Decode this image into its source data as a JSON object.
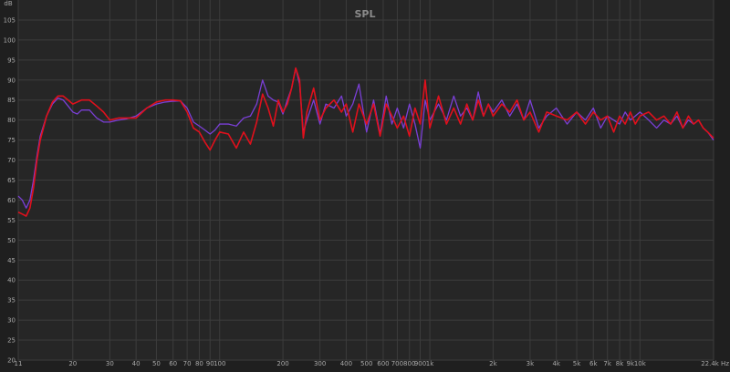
{
  "chart_data": {
    "type": "line",
    "title": "SPL",
    "ylabel": "dB",
    "xunit": "Hz",
    "xscale": "log",
    "grid": true,
    "xlim": [
      11,
      22400
    ],
    "ylim": [
      20,
      110
    ],
    "yticks": [
      20,
      25,
      30,
      35,
      40,
      45,
      50,
      55,
      60,
      65,
      70,
      75,
      80,
      85,
      90,
      95,
      100,
      105
    ],
    "xticks": [
      {
        "v": 11,
        "label": "11"
      },
      {
        "v": 20,
        "label": "20"
      },
      {
        "v": 30,
        "label": "30"
      },
      {
        "v": 40,
        "label": "40"
      },
      {
        "v": 50,
        "label": "50"
      },
      {
        "v": 60,
        "label": "60"
      },
      {
        "v": 70,
        "label": "70"
      },
      {
        "v": 80,
        "label": "80"
      },
      {
        "v": 90,
        "label": "90"
      },
      {
        "v": 100,
        "label": "100"
      },
      {
        "v": 200,
        "label": "200"
      },
      {
        "v": 300,
        "label": "300"
      },
      {
        "v": 400,
        "label": "400"
      },
      {
        "v": 500,
        "label": "500"
      },
      {
        "v": 600,
        "label": "600"
      },
      {
        "v": 700,
        "label": "700"
      },
      {
        "v": 800,
        "label": "800"
      },
      {
        "v": 900,
        "label": "900"
      },
      {
        "v": 1000,
        "label": "1k"
      },
      {
        "v": 2000,
        "label": "2k"
      },
      {
        "v": 3000,
        "label": "3k"
      },
      {
        "v": 4000,
        "label": "4k"
      },
      {
        "v": 5000,
        "label": "5k"
      },
      {
        "v": 6000,
        "label": "6k"
      },
      {
        "v": 7000,
        "label": "7k"
      },
      {
        "v": 8000,
        "label": "8k"
      },
      {
        "v": 9000,
        "label": "9k"
      },
      {
        "v": 10000,
        "label": "10k"
      },
      {
        "v": 22400,
        "label": "22.4k Hz"
      }
    ],
    "colors": {
      "series1": "#7a3fd6",
      "series2": "#e0101c",
      "background": "#262626",
      "grid": "#3c3c3c",
      "text": "#a8a8a8"
    },
    "series": [
      {
        "color": "#7a3fd6",
        "x": [
          11,
          11.5,
          12,
          12.5,
          13,
          13.5,
          14,
          15,
          16,
          17,
          18,
          19,
          20,
          21,
          22,
          24,
          26,
          28,
          30,
          33,
          36,
          40,
          45,
          50,
          55,
          60,
          65,
          70,
          75,
          80,
          85,
          90,
          95,
          100,
          110,
          120,
          130,
          140,
          150,
          160,
          170,
          180,
          190,
          200,
          210,
          220,
          230,
          240,
          250,
          260,
          280,
          300,
          320,
          350,
          380,
          400,
          430,
          460,
          500,
          540,
          580,
          620,
          660,
          700,
          750,
          800,
          850,
          900,
          950,
          1000,
          1100,
          1200,
          1300,
          1400,
          1500,
          1600,
          1700,
          1800,
          1900,
          2000,
          2200,
          2400,
          2600,
          2800,
          3000,
          3300,
          3600,
          4000,
          4500,
          5000,
          5500,
          6000,
          6500,
          7000,
          7500,
          8000,
          8500,
          9000,
          9500,
          10000,
          11000,
          12000,
          13000,
          14000,
          15000,
          16000,
          17000,
          18000,
          19000,
          20000,
          21000,
          22400
        ],
        "y": [
          61,
          60,
          58,
          60,
          65,
          71,
          76,
          81,
          84,
          85.5,
          85,
          83.5,
          82,
          81.5,
          82.5,
          82.5,
          80.5,
          79.5,
          79.5,
          80,
          80.3,
          81,
          83,
          84,
          84.5,
          84.7,
          84.8,
          83,
          79.5,
          78.5,
          77.5,
          76.5,
          77.5,
          79,
          79,
          78.5,
          80.5,
          81,
          84,
          90,
          86,
          85,
          84.5,
          81.5,
          85,
          88,
          93,
          89,
          77,
          80,
          85,
          79,
          84,
          83,
          86,
          81,
          84,
          89,
          77,
          85,
          76.5,
          86,
          79,
          83,
          78,
          84,
          79,
          73,
          85,
          80,
          84,
          80,
          86,
          81,
          83,
          80,
          87,
          81,
          84,
          82,
          85,
          81,
          84,
          80,
          85,
          78,
          81,
          83,
          79,
          82,
          80,
          83,
          78,
          81,
          80,
          79,
          82,
          80,
          81,
          82,
          80,
          78,
          80,
          79,
          81,
          78,
          80,
          79,
          80,
          78,
          77,
          75
        ]
      },
      {
        "color": "#e0101c",
        "x": [
          11,
          11.5,
          12,
          12.5,
          13,
          13.5,
          14,
          15,
          16,
          17,
          18,
          19,
          20,
          21,
          22,
          24,
          26,
          28,
          30,
          33,
          36,
          40,
          45,
          50,
          55,
          60,
          65,
          70,
          75,
          80,
          85,
          90,
          95,
          100,
          110,
          120,
          130,
          140,
          150,
          160,
          170,
          180,
          190,
          200,
          210,
          220,
          230,
          240,
          250,
          260,
          280,
          300,
          320,
          350,
          380,
          400,
          430,
          460,
          500,
          540,
          580,
          620,
          660,
          700,
          750,
          800,
          850,
          900,
          950,
          1000,
          1100,
          1200,
          1300,
          1400,
          1500,
          1600,
          1700,
          1800,
          1900,
          2000,
          2200,
          2400,
          2600,
          2800,
          3000,
          3300,
          3600,
          4000,
          4500,
          5000,
          5500,
          6000,
          6500,
          7000,
          7500,
          8000,
          8500,
          9000,
          9500,
          10000,
          11000,
          12000,
          13000,
          14000,
          15000,
          16000,
          17000,
          18000,
          19000,
          20000,
          21000,
          22400
        ],
        "y": [
          57,
          56.5,
          56,
          58,
          63,
          70,
          75,
          81,
          84.5,
          86,
          86,
          85,
          84,
          84.5,
          85,
          85,
          83.5,
          82,
          80,
          80.5,
          80.5,
          80.5,
          83,
          84.5,
          85,
          85,
          84.8,
          82,
          78,
          77,
          74.5,
          72.5,
          75,
          77,
          76.5,
          73,
          77,
          74,
          79.5,
          86.5,
          83,
          78.5,
          85,
          82,
          84,
          88,
          93,
          90,
          75.5,
          82,
          88,
          80,
          83,
          85,
          82,
          84,
          77,
          84,
          79,
          84,
          76,
          84,
          81,
          78,
          81,
          76,
          83,
          79,
          90,
          78,
          86,
          79,
          83,
          79,
          84,
          80,
          85,
          81,
          84,
          81,
          84,
          82,
          85,
          80,
          82,
          77,
          82,
          81,
          80,
          82,
          79,
          82,
          80,
          81,
          77,
          81,
          79,
          82,
          79,
          81,
          82,
          80,
          81,
          79,
          82,
          78,
          81,
          79,
          80,
          78,
          77,
          75.5
        ]
      }
    ]
  }
}
